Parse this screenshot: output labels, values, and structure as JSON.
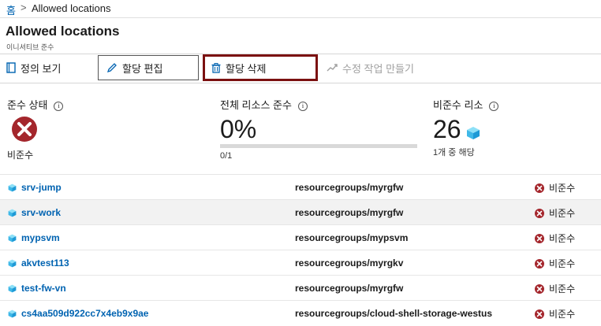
{
  "breadcrumb": {
    "home": "홈",
    "separator": ">",
    "current": "Allowed locations"
  },
  "header": {
    "title": "Allowed locations",
    "subtitle": "이니셔티브 준수"
  },
  "toolbar": {
    "view_definition": "정의 보기",
    "edit_assignment": "할당 편집",
    "delete_assignment": "할당 삭제",
    "create_remediation": "수정 작업 만들기"
  },
  "stats": {
    "compliance_state_label": "준수 상태",
    "compliance_state_value": "비준수",
    "resource_compliance_label": "전체 리소스 준수",
    "resource_compliance_value": "0%",
    "resource_compliance_fraction": "0/1",
    "resource_compliance_progress": 0,
    "noncompliant_label": "비준수 리소",
    "noncompliant_count": "26",
    "noncompliant_sub": "1개 중 해당"
  },
  "rows": [
    {
      "name": "srv-jump",
      "group": "resourcegroups/myrgfw",
      "status": "비준수"
    },
    {
      "name": "srv-work",
      "group": "resourcegroups/myrgfw",
      "status": "비준수"
    },
    {
      "name": "mypsvm",
      "group": "resourcegroups/mypsvm",
      "status": "비준수"
    },
    {
      "name": "akvtest113",
      "group": "resourcegroups/myrgkv",
      "status": "비준수"
    },
    {
      "name": "test-fw-vn",
      "group": "resourcegroups/myrgfw",
      "status": "비준수"
    },
    {
      "name": "cs4aa509d922cc7x4eb9x9ae",
      "group": "resourcegroups/cloud-shell-storage-westus",
      "status": "비준수"
    }
  ],
  "colors": {
    "link": "#0063b1",
    "error": "#a4262c",
    "highlight_border": "#7b1010"
  }
}
